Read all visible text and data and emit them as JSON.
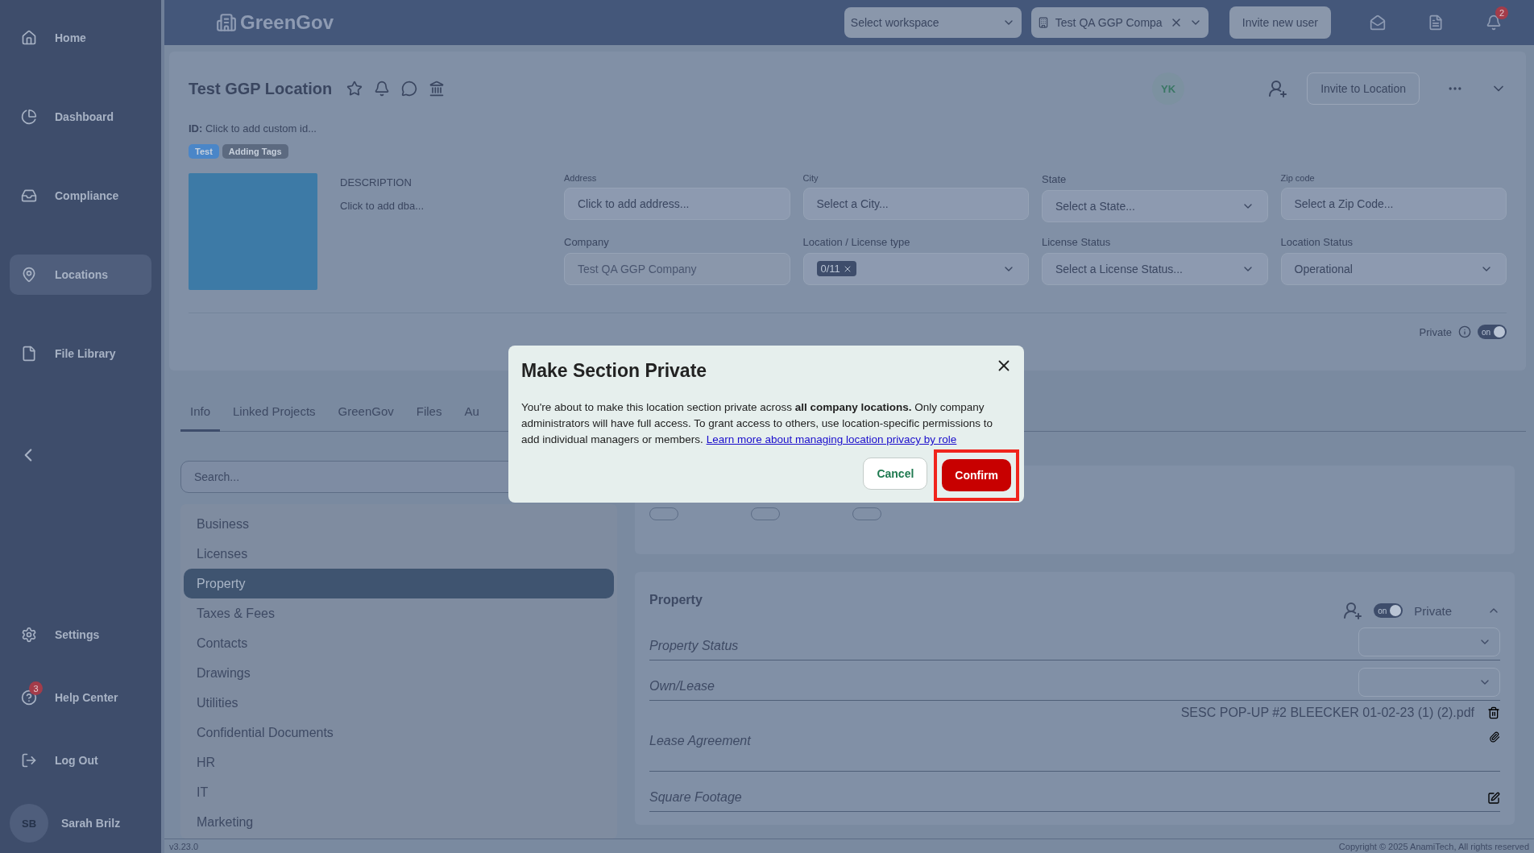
{
  "header": {
    "logo": "GreenGov",
    "workspace_select": {
      "placeholder": "Select workspace"
    },
    "company_select": {
      "value": "Test QA GGP Compa"
    },
    "invite_button": "Invite new user",
    "notification_count": "2"
  },
  "sidebar": {
    "items": [
      {
        "label": "Home",
        "selected": false
      },
      {
        "label": "Dashboard",
        "selected": false
      },
      {
        "label": "Compliance",
        "selected": false
      },
      {
        "label": "Locations",
        "selected": true
      },
      {
        "label": "File Library",
        "selected": false
      }
    ],
    "bottom_items": [
      {
        "label": "Settings"
      },
      {
        "label": "Help Center",
        "badge": "3"
      },
      {
        "label": "Log Out"
      }
    ],
    "user": {
      "initials": "SB",
      "name": "Sarah Brilz"
    }
  },
  "location": {
    "title": "Test GGP Location",
    "avatar": "YK",
    "invite_button": "Invite to Location",
    "id_label": "ID:",
    "id_placeholder": "Click to add custom id...",
    "tags": [
      {
        "label": "Test",
        "color": "#4a86c8"
      },
      {
        "label": "Adding Tags",
        "color": "#5c6a80"
      }
    ],
    "description_label": "DESCRIPTION",
    "description_placeholder": "Click to add dba...",
    "fields": [
      {
        "label": "Address",
        "kind": "text",
        "placeholder": "Click to add address..."
      },
      {
        "label": "City",
        "kind": "text",
        "placeholder": "Select a City..."
      },
      {
        "label": "State",
        "kind": "select",
        "placeholder": "Select a State..."
      },
      {
        "label": "Zip code",
        "kind": "text",
        "placeholder": "Select a Zip Code..."
      },
      {
        "label": "Company",
        "kind": "disabled",
        "value": "Test QA GGP Company"
      },
      {
        "label": "Location / License type",
        "kind": "multiselect",
        "chip": "0/11"
      },
      {
        "label": "License Status",
        "kind": "select",
        "placeholder": "Select a License Status..."
      },
      {
        "label": "Location Status",
        "kind": "select",
        "value": "Operational"
      }
    ],
    "private": {
      "label": "Private",
      "toggle_text": "on",
      "on": true
    }
  },
  "tabs": [
    {
      "label": "Info",
      "selected": true
    },
    {
      "label": "Linked Projects",
      "selected": false
    },
    {
      "label": "GreenGov",
      "selected": false
    },
    {
      "label": "Files",
      "selected": false
    },
    {
      "label": "Au",
      "selected": false
    }
  ],
  "search": {
    "placeholder": "Search..."
  },
  "sections": [
    {
      "label": "Business",
      "selected": false
    },
    {
      "label": "Licenses",
      "selected": false
    },
    {
      "label": "Property",
      "selected": true
    },
    {
      "label": "Taxes & Fees",
      "selected": false
    },
    {
      "label": "Contacts",
      "selected": false
    },
    {
      "label": "Drawings",
      "selected": false
    },
    {
      "label": "Utilities",
      "selected": false
    },
    {
      "label": "Confidential Documents",
      "selected": false
    },
    {
      "label": "HR",
      "selected": false
    },
    {
      "label": "IT",
      "selected": false
    },
    {
      "label": "Marketing",
      "selected": false
    }
  ],
  "section_panel": {
    "toggles": [
      {
        "on": false
      },
      {
        "on": false
      },
      {
        "on": false
      }
    ]
  },
  "property_panel": {
    "title": "Property",
    "toggle_text": "on",
    "private_on": true,
    "private_label": "Private",
    "expanded": true,
    "rows": [
      {
        "label": "Property Status",
        "kind": "select"
      },
      {
        "label": "Own/Lease",
        "kind": "select"
      },
      {
        "label": "Lease Agreement",
        "kind": "file",
        "file": "SESC POP-UP #2 BLEECKER 01-02-23 (1) (2).pdf"
      },
      {
        "label": "Square Footage",
        "kind": "edit"
      }
    ]
  },
  "modal": {
    "title": "Make Section Private",
    "body": "You're about to make this location section private across **all company locations.** Only company administrators will have full access. To grant access to others, use location-specific permissions to add individual managers or members.",
    "link": "Learn more about managing location privacy by role",
    "cancel": "Cancel",
    "confirm": "Confirm",
    "confirm_highlighted": true
  },
  "footer": {
    "version": "v3.23.0",
    "copyright": "Copyright © 2025 AnamiTech, All rights reserved"
  }
}
